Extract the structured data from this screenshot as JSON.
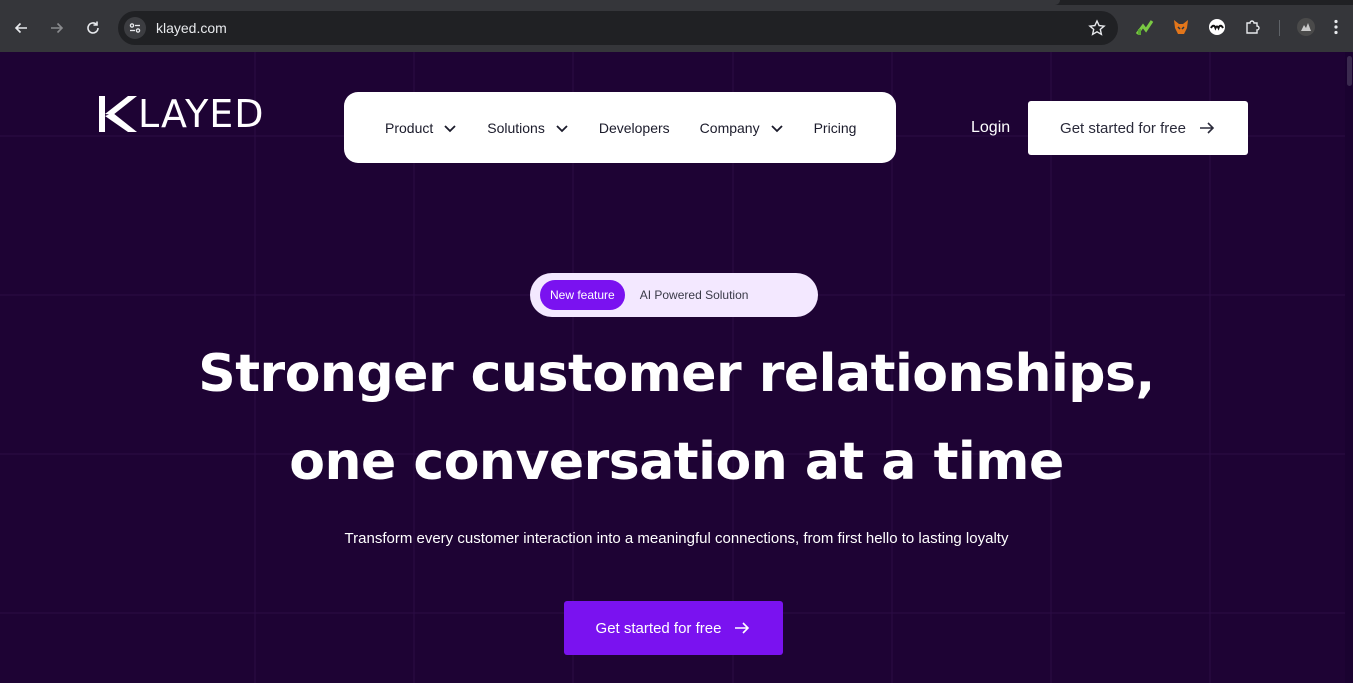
{
  "browser": {
    "url": "klayed.com",
    "icons": [
      "back-icon",
      "forward-icon",
      "reload-icon",
      "site-info-icon",
      "bookmark-star-icon",
      "extension-chart-icon",
      "extension-fox-icon",
      "extension-mask-icon",
      "extensions-puzzle-icon",
      "profile-avatar-icon",
      "menu-icon"
    ]
  },
  "header": {
    "logo_text": "LAYED",
    "nav": [
      {
        "label": "Product",
        "dropdown": true
      },
      {
        "label": "Solutions",
        "dropdown": true
      },
      {
        "label": "Developers",
        "dropdown": false
      },
      {
        "label": "Company",
        "dropdown": true
      },
      {
        "label": "Pricing",
        "dropdown": false
      }
    ],
    "login": "Login",
    "cta": "Get started for free"
  },
  "hero": {
    "badge": "New feature",
    "badge_text": "AI Powered Solution",
    "headline_line1": "Stronger customer relationships,",
    "headline_line2": "one conversation at a time",
    "subtitle": "Transform every customer interaction into a meaningful connections, from first hello to lasting loyalty",
    "cta": "Get started for free"
  },
  "colors": {
    "background": "#1e0334",
    "accent": "#7a12f0",
    "pill_bg": "#f3e8ff"
  }
}
